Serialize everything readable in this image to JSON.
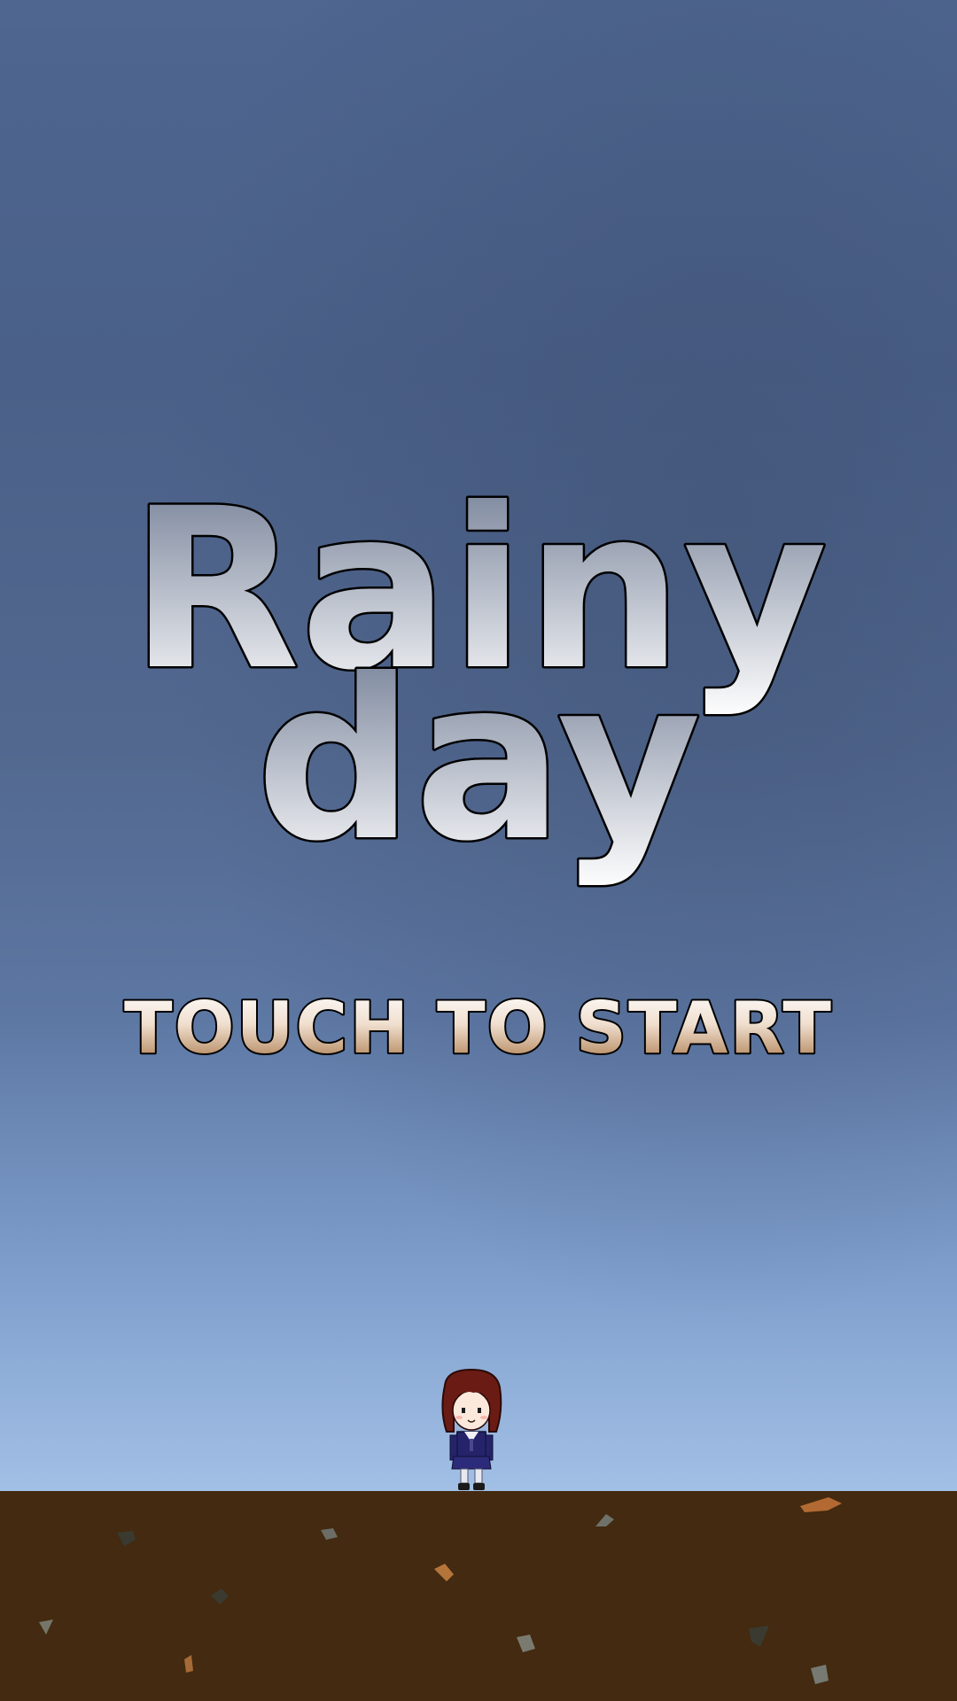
{
  "title": {
    "line1": "Rainy",
    "line2": "day"
  },
  "start_prompt": "TOUCH TO START",
  "colors": {
    "sky_top": "#4e6690",
    "sky_bottom": "#a2c0e6",
    "ground": "#432a10",
    "title_fill_top": "#6f7b93",
    "title_fill_bottom": "#ffffff",
    "start_fill_top": "#ffffff",
    "start_fill_bottom": "#a4703f",
    "character_hair": "#6a1c14",
    "character_uniform": "#25236a"
  },
  "sprites": {
    "player": "schoolgirl-character"
  }
}
